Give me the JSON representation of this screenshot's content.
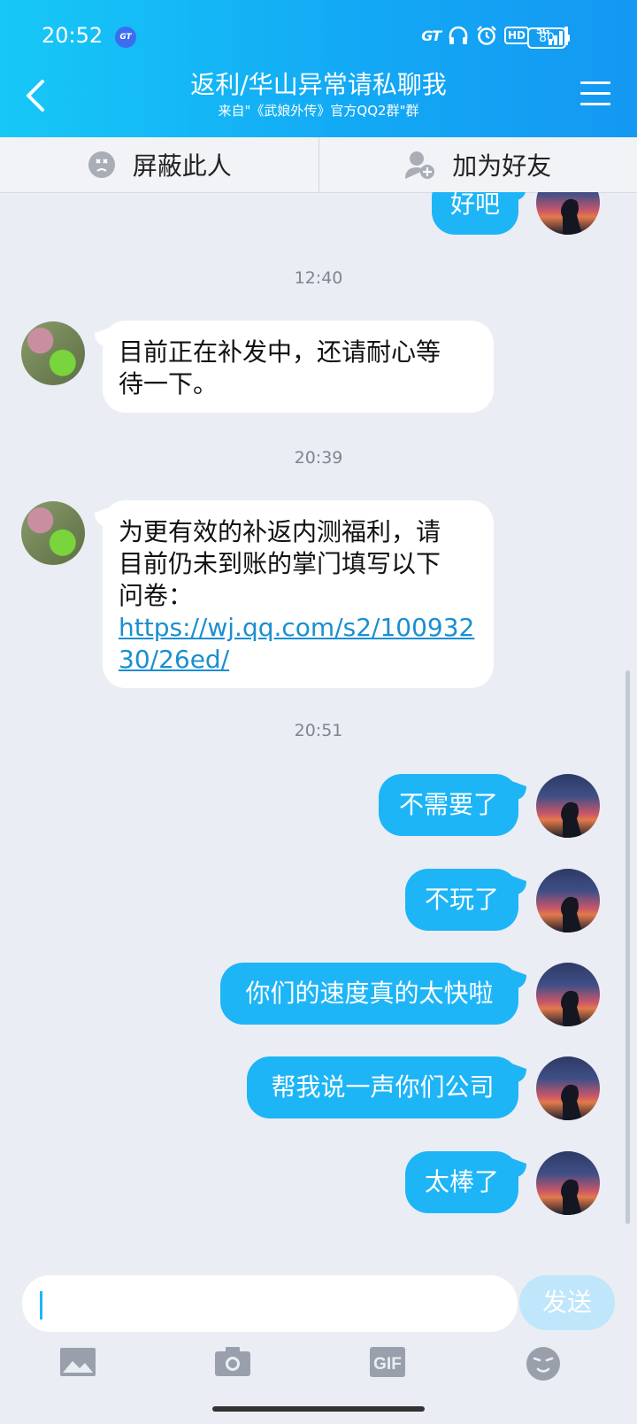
{
  "status_bar": {
    "time": "20:52",
    "left_badge": "GT",
    "network_badge": "GT",
    "hd": "HD",
    "signal_type": "5G",
    "battery": "80"
  },
  "header": {
    "title": "返利/华山异常请私聊我",
    "subtitle": "来自\"《武娘外传》官方QQ2群\"群"
  },
  "actions": {
    "block": "屏蔽此人",
    "add_friend": "加为好友"
  },
  "messages": [
    {
      "side": "out",
      "text": "好吧"
    },
    {
      "type": "time",
      "text": "12:40"
    },
    {
      "side": "in",
      "lines": [
        "目前正在补发中，还请耐心等",
        "待一下。"
      ]
    },
    {
      "type": "time",
      "text": "20:39"
    },
    {
      "side": "in",
      "lines": [
        "为更有效的补返内测福利，请",
        "目前仍未到账的掌门填写以下",
        "问卷："
      ],
      "link_lines": [
        "https://wj.qq.com/s2/100932",
        "30/26ed/"
      ]
    },
    {
      "type": "time",
      "text": "20:51"
    },
    {
      "side": "out",
      "text": "不需要了"
    },
    {
      "side": "out",
      "text": "不玩了"
    },
    {
      "side": "out",
      "text": "你们的速度真的太快啦"
    },
    {
      "side": "out",
      "text": "帮我说一声你们公司"
    },
    {
      "side": "out",
      "text": "太棒了"
    }
  ],
  "input": {
    "value": "",
    "send_label": "发送"
  },
  "toolbar": {
    "gif_label": "GIF"
  },
  "colors": {
    "header_start": "#16c8f6",
    "header_end": "#1498f2",
    "bubble_out": "#1eb5f7",
    "link": "#1a8fd0"
  }
}
